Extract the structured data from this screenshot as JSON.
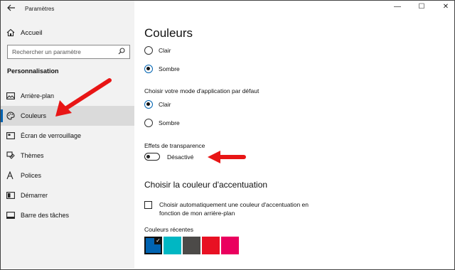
{
  "window": {
    "title": "Paramètres",
    "minimize": "—",
    "maximize": "☐",
    "close": "✕"
  },
  "sidebar": {
    "home_label": "Accueil",
    "search_placeholder": "Rechercher un paramètre",
    "section_title": "Personnalisation",
    "items": [
      {
        "label": "Arrière-plan",
        "icon": "image-icon"
      },
      {
        "label": "Couleurs",
        "icon": "palette-icon",
        "active": true
      },
      {
        "label": "Écran de verrouillage",
        "icon": "lock-screen-icon"
      },
      {
        "label": "Thèmes",
        "icon": "brush-icon"
      },
      {
        "label": "Polices",
        "icon": "font-icon"
      },
      {
        "label": "Démarrer",
        "icon": "start-icon"
      },
      {
        "label": "Barre des tâches",
        "icon": "taskbar-icon"
      }
    ]
  },
  "main": {
    "title": "Couleurs",
    "mode_options": [
      {
        "label": "Clair",
        "checked": false
      },
      {
        "label": "Sombre",
        "checked": true
      }
    ],
    "app_mode_label": "Choisir votre mode d'application par défaut",
    "app_mode_options": [
      {
        "label": "Clair",
        "checked": true
      },
      {
        "label": "Sombre",
        "checked": false
      }
    ],
    "transparency_label": "Effets de transparence",
    "transparency_state": "Désactivé",
    "accent_title": "Choisir la couleur d'accentuation",
    "auto_accent_label": "Choisir automatiquement une couleur d'accentuation en fonction de mon arrière-plan",
    "recent_colors_label": "Couleurs récentes",
    "recent_colors": [
      "#0063b1",
      "#00b7c3",
      "#4c4a48",
      "#e81123",
      "#ea005e"
    ]
  },
  "colors": {
    "accent": "#0063b1",
    "annotation_arrow": "#e81515"
  }
}
